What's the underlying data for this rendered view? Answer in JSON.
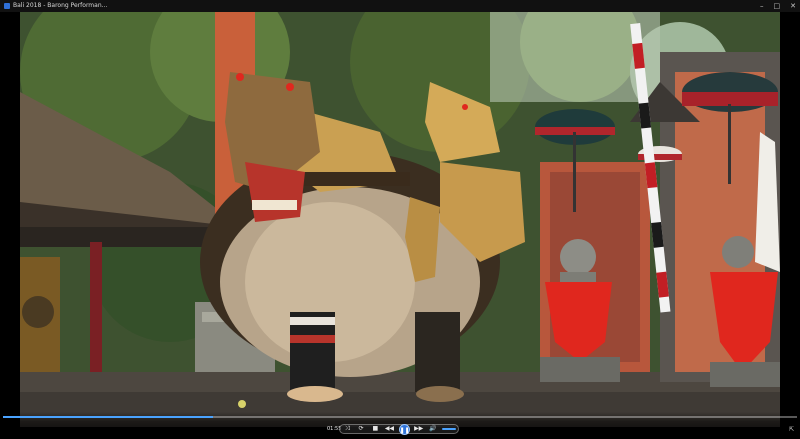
{
  "window": {
    "title": "Bali 2018 - Barong Performan...",
    "minimize_label": "–",
    "maximize_label": "□",
    "close_label": "✕"
  },
  "player": {
    "timecode": "01:55",
    "progress_fraction": 0.265,
    "accent_color": "#4aa3ff",
    "buttons": {
      "shuffle": "⤨",
      "repeat": "⟳",
      "stop": "■",
      "previous": "◀◀",
      "play_pause": "❚❚",
      "next": "▶▶",
      "volume": "🔊"
    },
    "switch_view_label": "⇱"
  }
}
